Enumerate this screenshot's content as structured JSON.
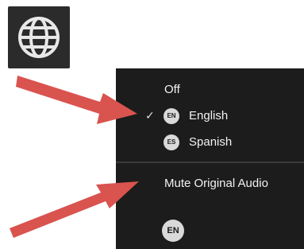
{
  "toolbar": {
    "globe_icon": "globe-icon"
  },
  "language_menu": {
    "items": [
      {
        "label": "Off",
        "selected": false
      },
      {
        "label": "English",
        "badge": "EN",
        "selected": true
      },
      {
        "label": "Spanish",
        "badge": "ES",
        "selected": false
      }
    ],
    "check_mark": "✓",
    "mute_label": "Mute Original Audio",
    "footer_badge": "EN"
  },
  "annotation": {
    "arrow_color": "#d9534f"
  }
}
